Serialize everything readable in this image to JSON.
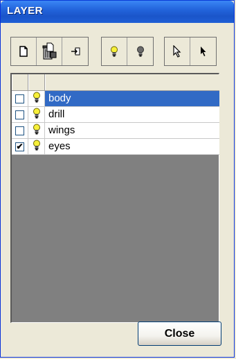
{
  "window": {
    "title": "LAYER"
  },
  "toolbar": {
    "groups": [
      {
        "buttons": [
          "new-layer-icon",
          "delete-layer-icon",
          "import-icon"
        ]
      },
      {
        "buttons": [
          "bulb-on-icon",
          "bulb-off-icon"
        ]
      },
      {
        "buttons": [
          "select-arrow-outline-icon",
          "select-arrow-filled-icon"
        ]
      }
    ]
  },
  "layers": [
    {
      "name": "body",
      "checked": "",
      "selected": true
    },
    {
      "name": "drill",
      "checked": "",
      "selected": false
    },
    {
      "name": "wings",
      "checked": "",
      "selected": false
    },
    {
      "name": "eyes",
      "checked": "✔",
      "selected": false
    }
  ],
  "colors": {
    "title_bar": "#2364dc",
    "selection": "#316ac5",
    "list_background": "#808080",
    "bulb": "#f7f03a"
  },
  "buttons": {
    "close_label": "Close"
  }
}
